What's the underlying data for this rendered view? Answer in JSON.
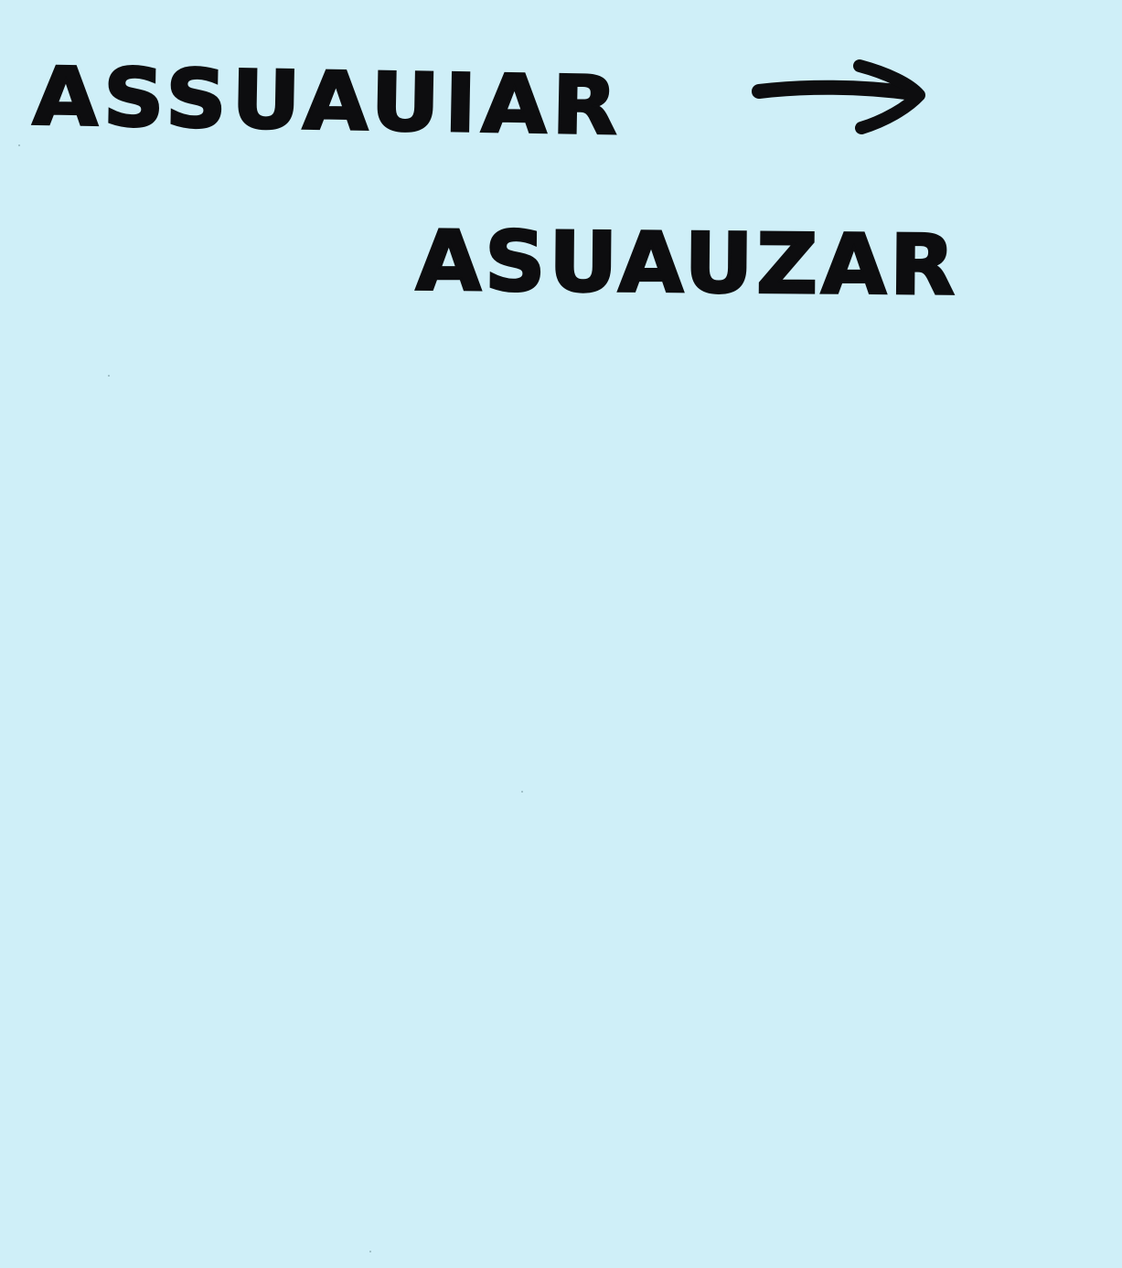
{
  "note": {
    "background_color": "#cfeff8",
    "ink_color": "#0d0d0f",
    "line1": "ASSUAUIAR",
    "arrow_icon": "right-arrow-icon",
    "line2": "ASUAUZAR"
  }
}
